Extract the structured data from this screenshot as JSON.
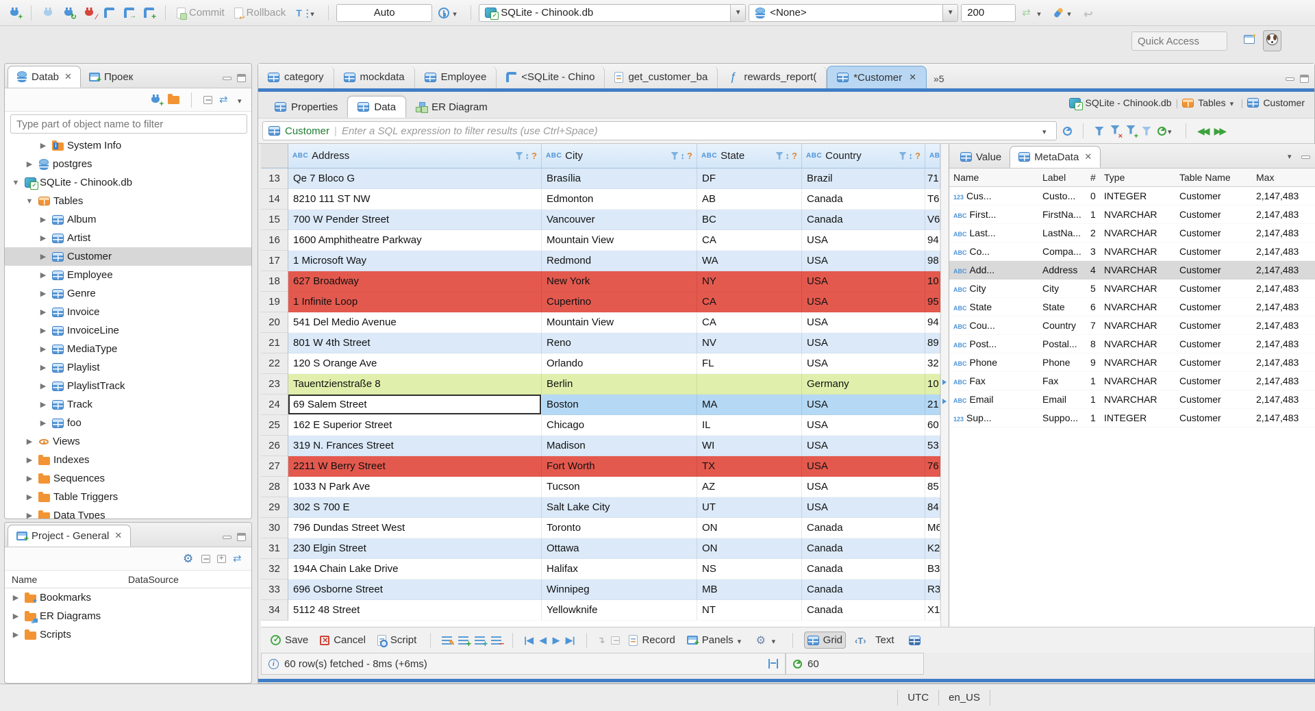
{
  "topbar": {
    "auto_label": "Auto",
    "commit_label": "Commit",
    "rollback_label": "Rollback",
    "database_combo": "SQLite - Chinook.db",
    "schema_combo": "<None>",
    "fetch_size": "200",
    "quick_access_placeholder": "Quick Access"
  },
  "nav_panel": {
    "tab_database": "Datab",
    "tab_projects": "Проек",
    "filter_placeholder": "Type part of object name to filter",
    "tree": [
      {
        "arrow": "▶",
        "icon": "folder-info",
        "icon_name": "system-info-folder-icon",
        "label": "System Info",
        "level": "2"
      },
      {
        "arrow": "▶",
        "icon": "database",
        "icon_name": "postgres-database-icon",
        "label": "postgres",
        "level": "1"
      },
      {
        "arrow": "▼",
        "icon": "sqlite",
        "icon_name": "sqlite-connection-icon",
        "label": "SQLite - Chinook.db",
        "level": "0"
      },
      {
        "arrow": "▼",
        "icon": "tables",
        "icon_name": "tables-folder-icon",
        "label": "Tables",
        "level": "1"
      },
      {
        "arrow": "▶",
        "icon": "table",
        "icon_name": "table-icon",
        "label": "Album",
        "level": "2"
      },
      {
        "arrow": "▶",
        "icon": "table",
        "icon_name": "table-icon",
        "label": "Artist",
        "level": "2"
      },
      {
        "arrow": "▶",
        "icon": "table",
        "icon_name": "table-icon",
        "label": "Customer",
        "level": "2",
        "variant": "selected"
      },
      {
        "arrow": "▶",
        "icon": "table",
        "icon_name": "table-icon",
        "label": "Employee",
        "level": "2"
      },
      {
        "arrow": "▶",
        "icon": "table",
        "icon_name": "table-icon",
        "label": "Genre",
        "level": "2"
      },
      {
        "arrow": "▶",
        "icon": "table",
        "icon_name": "table-icon",
        "label": "Invoice",
        "level": "2"
      },
      {
        "arrow": "▶",
        "icon": "table",
        "icon_name": "table-icon",
        "label": "InvoiceLine",
        "level": "2"
      },
      {
        "arrow": "▶",
        "icon": "table",
        "icon_name": "table-icon",
        "label": "MediaType",
        "level": "2"
      },
      {
        "arrow": "▶",
        "icon": "table",
        "icon_name": "table-icon",
        "label": "Playlist",
        "level": "2"
      },
      {
        "arrow": "▶",
        "icon": "table",
        "icon_name": "table-icon",
        "label": "PlaylistTrack",
        "level": "2"
      },
      {
        "arrow": "▶",
        "icon": "table",
        "icon_name": "table-icon",
        "label": "Track",
        "level": "2"
      },
      {
        "arrow": "▶",
        "icon": "table",
        "icon_name": "table-icon",
        "label": "foo",
        "level": "2"
      },
      {
        "arrow": "▶",
        "icon": "eye",
        "icon_name": "views-icon",
        "label": "Views",
        "level": "1"
      },
      {
        "arrow": "▶",
        "icon": "folder",
        "icon_name": "folder-icon",
        "label": "Indexes",
        "level": "1"
      },
      {
        "arrow": "▶",
        "icon": "folder",
        "icon_name": "folder-icon",
        "label": "Sequences",
        "level": "1"
      },
      {
        "arrow": "▶",
        "icon": "folder",
        "icon_name": "folder-icon",
        "label": "Table Triggers",
        "level": "1"
      },
      {
        "arrow": "▶",
        "icon": "folder",
        "icon_name": "folder-icon",
        "label": "Data Types",
        "level": "1"
      }
    ]
  },
  "project_panel": {
    "title": "Project - General",
    "col_name": "Name",
    "col_datasource": "DataSource",
    "items": [
      {
        "arrow": "▶",
        "icon": "folder-bookmark",
        "icon_name": "bookmarks-folder-icon",
        "label": "Bookmarks"
      },
      {
        "arrow": "▶",
        "icon": "folder-er",
        "icon_name": "er-diagrams-folder-icon",
        "label": "ER Diagrams"
      },
      {
        "arrow": "▶",
        "icon": "folder",
        "icon_name": "scripts-folder-icon",
        "label": "Scripts"
      }
    ]
  },
  "editor": {
    "tabs": [
      {
        "icon": "table",
        "icon_name": "table-icon",
        "label": "category"
      },
      {
        "icon": "table",
        "icon_name": "table-icon",
        "label": "mockdata"
      },
      {
        "icon": "table",
        "icon_name": "table-icon",
        "label": "Employee"
      },
      {
        "icon": "sql",
        "icon_name": "sql-editor-icon",
        "label": "<SQLite - Chino"
      },
      {
        "icon": "script",
        "icon_name": "script-icon",
        "label": "get_customer_ba"
      },
      {
        "icon": "function",
        "icon_name": "function-icon",
        "label": "rewards_report("
      },
      {
        "icon": "table",
        "icon_name": "table-icon",
        "label": "*Customer",
        "variant": "active"
      }
    ],
    "overflow": "»5",
    "subtabs": [
      {
        "icon": "properties",
        "icon_name": "properties-icon",
        "label": "Properties"
      },
      {
        "icon": "data",
        "icon_name": "data-icon",
        "label": "Data",
        "variant": "active"
      },
      {
        "icon": "er",
        "icon_name": "er-diagram-icon",
        "label": "ER Diagram"
      }
    ],
    "breadcrumb": {
      "db": "SQLite - Chinook.db",
      "tables": "Tables",
      "table": "Customer"
    },
    "filter": {
      "table_name": "Customer",
      "placeholder": "Enter a SQL expression to filter results (use Ctrl+Space)"
    }
  },
  "grid": {
    "type_tag": "ABC",
    "columns": [
      {
        "name": "Address"
      },
      {
        "name": "City"
      },
      {
        "name": "State"
      },
      {
        "name": "Country"
      },
      {
        "name": ""
      }
    ],
    "rows": [
      {
        "num": "13",
        "address": "Qe 7 Bloco G",
        "city": "Brasília",
        "state": "DF",
        "country": "Brazil",
        "postal": "71",
        "variant": "alt"
      },
      {
        "num": "14",
        "address": "8210 111 ST NW",
        "city": "Edmonton",
        "state": "AB",
        "country": "Canada",
        "postal": "T6",
        "variant": "plain"
      },
      {
        "num": "15",
        "address": "700 W Pender Street",
        "city": "Vancouver",
        "state": "BC",
        "country": "Canada",
        "postal": "V6",
        "variant": "alt"
      },
      {
        "num": "16",
        "address": "1600 Amphitheatre Parkway",
        "city": "Mountain View",
        "state": "CA",
        "country": "USA",
        "postal": "94",
        "variant": "plain"
      },
      {
        "num": "17",
        "address": "1 Microsoft Way",
        "city": "Redmond",
        "state": "WA",
        "country": "USA",
        "postal": "98",
        "variant": "alt"
      },
      {
        "num": "18",
        "address": "627 Broadway",
        "city": "New York",
        "state": "NY",
        "country": "USA",
        "postal": "10",
        "variant": "red"
      },
      {
        "num": "19",
        "address": "1 Infinite Loop",
        "city": "Cupertino",
        "state": "CA",
        "country": "USA",
        "postal": "95",
        "variant": "red"
      },
      {
        "num": "20",
        "address": "541 Del Medio Avenue",
        "city": "Mountain View",
        "state": "CA",
        "country": "USA",
        "postal": "94",
        "variant": "plain"
      },
      {
        "num": "21",
        "address": "801 W 4th Street",
        "city": "Reno",
        "state": "NV",
        "country": "USA",
        "postal": "89",
        "variant": "alt"
      },
      {
        "num": "22",
        "address": "120 S Orange Ave",
        "city": "Orlando",
        "state": "FL",
        "country": "USA",
        "postal": "32",
        "variant": "plain"
      },
      {
        "num": "23",
        "address": "Tauentzienstraße 8",
        "city": "Berlin",
        "state": "",
        "country": "Germany",
        "postal": "10",
        "variant": "green"
      },
      {
        "num": "24",
        "address": "69 Salem Street",
        "city": "Boston",
        "state": "MA",
        "country": "USA",
        "postal": "21",
        "variant": "selected"
      },
      {
        "num": "25",
        "address": "162 E Superior Street",
        "city": "Chicago",
        "state": "IL",
        "country": "USA",
        "postal": "60",
        "variant": "plain"
      },
      {
        "num": "26",
        "address": "319 N. Frances Street",
        "city": "Madison",
        "state": "WI",
        "country": "USA",
        "postal": "53",
        "variant": "alt"
      },
      {
        "num": "27",
        "address": "2211 W Berry Street",
        "city": "Fort Worth",
        "state": "TX",
        "country": "USA",
        "postal": "76",
        "variant": "red"
      },
      {
        "num": "28",
        "address": "1033 N Park Ave",
        "city": "Tucson",
        "state": "AZ",
        "country": "USA",
        "postal": "85",
        "variant": "plain"
      },
      {
        "num": "29",
        "address": "302 S 700 E",
        "city": "Salt Lake City",
        "state": "UT",
        "country": "USA",
        "postal": "84",
        "variant": "alt"
      },
      {
        "num": "30",
        "address": "796 Dundas Street West",
        "city": "Toronto",
        "state": "ON",
        "country": "Canada",
        "postal": "M6",
        "variant": "plain"
      },
      {
        "num": "31",
        "address": "230 Elgin Street",
        "city": "Ottawa",
        "state": "ON",
        "country": "Canada",
        "postal": "K2",
        "variant": "alt"
      },
      {
        "num": "32",
        "address": "194A Chain Lake Drive",
        "city": "Halifax",
        "state": "NS",
        "country": "Canada",
        "postal": "B3",
        "variant": "plain"
      },
      {
        "num": "33",
        "address": "696 Osborne Street",
        "city": "Winnipeg",
        "state": "MB",
        "country": "Canada",
        "postal": "R3",
        "variant": "alt"
      },
      {
        "num": "34",
        "address": "5112 48 Street",
        "city": "Yellowknife",
        "state": "NT",
        "country": "Canada",
        "postal": "X1",
        "variant": "plain"
      }
    ]
  },
  "metadata": {
    "tab_value": "Value",
    "tab_metadata": "MetaData",
    "columns": {
      "name": "Name",
      "label": "Label",
      "num": "#",
      "type": "Type",
      "table": "Table Name",
      "max": "Max"
    },
    "rows": [
      {
        "tag": "123",
        "name": "Cus...",
        "label": "Custo...",
        "num": "0",
        "type": "INTEGER",
        "table": "Customer",
        "max": "2,147,483"
      },
      {
        "tag": "ABC",
        "name": "First...",
        "label": "FirstNa...",
        "num": "1",
        "type": "NVARCHAR",
        "table": "Customer",
        "max": "2,147,483"
      },
      {
        "tag": "ABC",
        "name": "Last...",
        "label": "LastNa...",
        "num": "2",
        "type": "NVARCHAR",
        "table": "Customer",
        "max": "2,147,483"
      },
      {
        "tag": "ABC",
        "name": "Co...",
        "label": "Compa...",
        "num": "3",
        "type": "NVARCHAR",
        "table": "Customer",
        "max": "2,147,483"
      },
      {
        "tag": "ABC",
        "name": "Add...",
        "label": "Address",
        "num": "4",
        "type": "NVARCHAR",
        "table": "Customer",
        "max": "2,147,483",
        "variant": "selected"
      },
      {
        "tag": "ABC",
        "name": "City",
        "label": "City",
        "num": "5",
        "type": "NVARCHAR",
        "table": "Customer",
        "max": "2,147,483"
      },
      {
        "tag": "ABC",
        "name": "State",
        "label": "State",
        "num": "6",
        "type": "NVARCHAR",
        "table": "Customer",
        "max": "2,147,483"
      },
      {
        "tag": "ABC",
        "name": "Cou...",
        "label": "Country",
        "num": "7",
        "type": "NVARCHAR",
        "table": "Customer",
        "max": "2,147,483"
      },
      {
        "tag": "ABC",
        "name": "Post...",
        "label": "Postal...",
        "num": "8",
        "type": "NVARCHAR",
        "table": "Customer",
        "max": "2,147,483"
      },
      {
        "tag": "ABC",
        "name": "Phone",
        "label": "Phone",
        "num": "9",
        "type": "NVARCHAR",
        "table": "Customer",
        "max": "2,147,483"
      },
      {
        "tag": "ABC",
        "name": "Fax",
        "label": "Fax",
        "num": "1",
        "type": "NVARCHAR",
        "table": "Customer",
        "max": "2,147,483"
      },
      {
        "tag": "ABC",
        "name": "Email",
        "label": "Email",
        "num": "1",
        "type": "NVARCHAR",
        "table": "Customer",
        "max": "2,147,483"
      },
      {
        "tag": "123",
        "name": "Sup...",
        "label": "Suppo...",
        "num": "1",
        "type": "INTEGER",
        "table": "Customer",
        "max": "2,147,483"
      }
    ]
  },
  "result_toolbar": {
    "save": "Save",
    "cancel": "Cancel",
    "script": "Script",
    "record": "Record",
    "panels": "Panels",
    "grid": "Grid",
    "text": "Text"
  },
  "status": {
    "message": "60 row(s) fetched - 8ms (+6ms)",
    "refresh_value": "60"
  },
  "statusbar": {
    "timezone": "UTC",
    "locale": "en_US"
  }
}
